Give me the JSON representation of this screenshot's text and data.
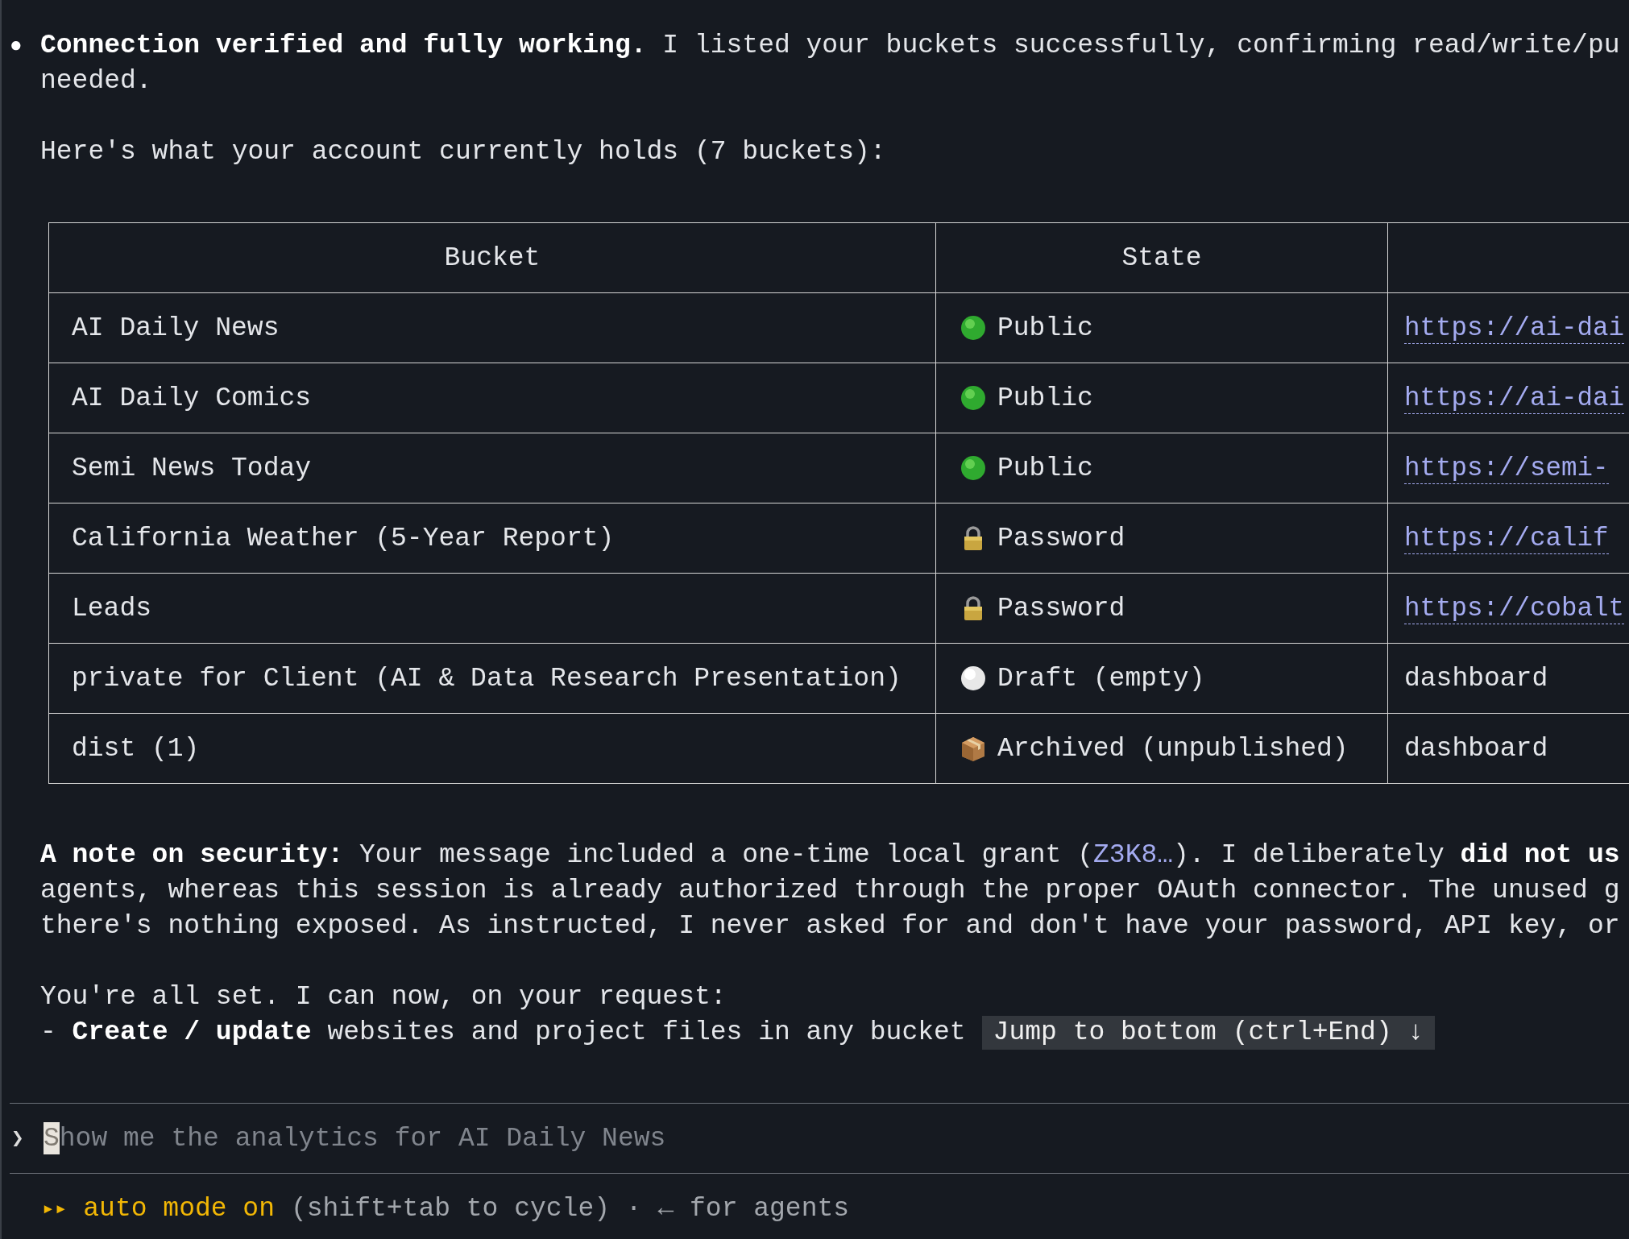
{
  "message": {
    "bullet": "●",
    "intro_lines": [
      "**Connection verified and fully working.** I listed your buckets successfully, confirming read/write/pu",
      "needed."
    ],
    "summary": "Here's what your account currently holds (7 buckets):",
    "table": {
      "columns": [
        "Bucket",
        "State"
      ],
      "rows": [
        {
          "bucket": "AI Daily News",
          "state": {
            "kind": "public",
            "label": "Public"
          },
          "column_3": {
            "kind": "link",
            "text": "https://ai-dai"
          }
        },
        {
          "bucket": "AI Daily Comics",
          "state": {
            "kind": "public",
            "label": "Public"
          },
          "column_3": {
            "kind": "link",
            "text": "https://ai-dai"
          }
        },
        {
          "bucket": "Semi News Today",
          "state": {
            "kind": "public",
            "label": "Public"
          },
          "column_3": {
            "kind": "link",
            "text": "https://semi-"
          }
        },
        {
          "bucket": "California Weather (5-Year Report)",
          "state": {
            "kind": "password",
            "label": "Password"
          },
          "column_3": {
            "kind": "link",
            "text": "https://calif"
          }
        },
        {
          "bucket": "Leads",
          "state": {
            "kind": "password",
            "label": "Password"
          },
          "column_3": {
            "kind": "link",
            "text": "https://cobalt"
          }
        },
        {
          "bucket": "private for Client (AI & Data Research Presentation)",
          "state": {
            "kind": "draft",
            "label": "Draft (empty)"
          },
          "column_3": {
            "kind": "text",
            "text": "dashboard"
          }
        },
        {
          "bucket": "dist (1)",
          "state": {
            "kind": "archived",
            "label": "Archived (unpublished)"
          },
          "column_3": {
            "kind": "text",
            "text": "dashboard"
          }
        }
      ]
    },
    "note_lines": [
      [
        {
          "kind": "text",
          "text": "**A note on security:** Your message included a one-time local grant ("
        },
        {
          "kind": "code",
          "text": "Z3K8…"
        },
        {
          "kind": "text",
          "text": "). I deliberately **did not us**"
        }
      ],
      [
        {
          "kind": "text",
          "text": "agents, whereas this session is already authorized through the proper OAuth connector. The unused g"
        }
      ],
      [
        {
          "kind": "text",
          "text": "there's nothing exposed. As instructed, I never asked for and don't have your password, API key, or"
        }
      ]
    ],
    "closing_lines": [
      "You're all set. I can now, on your request:",
      "- **Create / update** websites and project files in any bucket"
    ]
  },
  "jump_button": {
    "label": "Jump to bottom (ctrl+End) ↓"
  },
  "prompt": {
    "symbol": "❯",
    "placeholder": "Show me the analytics for AI Daily News"
  },
  "status_bar": {
    "mode_icon": "▸▸",
    "mode": "auto mode on",
    "hint": "(shift+tab to cycle) · ← for agents"
  }
}
